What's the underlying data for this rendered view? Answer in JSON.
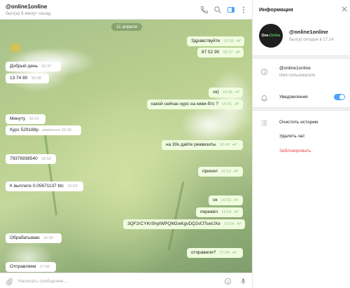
{
  "chat": {
    "title": "@online1online",
    "status": "был(а) 6 минут назад",
    "header_icons": [
      "phone-icon",
      "search-icon",
      "sidebar-toggle-icon",
      "more-vert-icon"
    ],
    "date_chip": "11 апреля",
    "messages": [
      {
        "dir": "out",
        "text": "Здравствуйте",
        "time": "16:36",
        "read": true
      },
      {
        "dir": "out",
        "text": "87 52 90",
        "time": "16:37",
        "read": true
      },
      {
        "dir": "in",
        "text": "Добрый день",
        "time": "16:37"
      },
      {
        "dir": "in",
        "text": "13 74 80",
        "time": "16:38"
      },
      {
        "dir": "out",
        "text": "ок)",
        "time": "16:38",
        "read": true
      },
      {
        "dir": "out",
        "text": "какой сейчас курс на киви-бтс ?",
        "time": "16:41",
        "read": true
      },
      {
        "dir": "in",
        "text": "Минуту",
        "time": "16:41"
      },
      {
        "dir": "in",
        "text": "Курс 529188р",
        "time": "изменено 16:42"
      },
      {
        "dir": "out",
        "text": "на 30к дайте реквизиты",
        "time": "16:49",
        "read": true
      },
      {
        "dir": "in",
        "text": "79376938540",
        "time": "16:52"
      },
      {
        "dir": "out",
        "text": "принял",
        "time": "16:52",
        "read": true
      },
      {
        "dir": "in",
        "text": "К выплате 0.05671137 btc",
        "time": "16:53"
      },
      {
        "dir": "out",
        "text": "ок",
        "time": "16:53",
        "read": true
      },
      {
        "dir": "out",
        "text": "перевёл",
        "time": "16:54",
        "read": true
      },
      {
        "dir": "out",
        "text": "3QF2rCYKrShytWPQM2wKgvDQ2vfJTswUXe",
        "time": "16:54",
        "read": true
      },
      {
        "dir": "in",
        "text": "Обрабатываю",
        "time": "16:55"
      },
      {
        "dir": "out",
        "text": "отправили?",
        "time": "17:04",
        "read": true
      },
      {
        "dir": "in",
        "text": "Отправляем",
        "time": "17:06"
      }
    ],
    "composer": {
      "placeholder": "Написать сообщение...",
      "value": ""
    }
  },
  "info": {
    "title": "Информация",
    "avatar_text": {
      "part1": "One-",
      "part2": "Online"
    },
    "profile_name": "@online1online",
    "profile_status": "был(а) сегодня в 17:14",
    "username_value": "@online1online",
    "username_label": "Имя пользователя",
    "notifications_label": "Уведомления",
    "notifications_on": true,
    "actions": {
      "clear_history": "Очистить историю",
      "delete_chat": "Удалить чат",
      "block": "Заблокировать"
    },
    "accent_color": "#4ea4f6",
    "danger_color": "#e5484d"
  }
}
